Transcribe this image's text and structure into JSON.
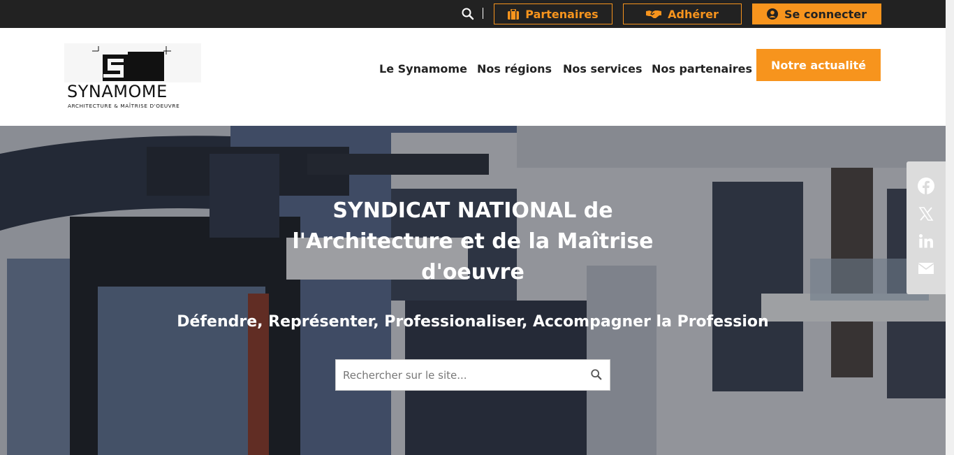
{
  "topbar": {
    "partners_label": "Partenaires",
    "join_label": "Adhérer",
    "login_label": "Se connecter"
  },
  "logo": {
    "name": "SYNAMOME",
    "tagline": "ARCHITECTURE & MAÎTRISE D'OEUVRE"
  },
  "nav": {
    "items": [
      {
        "label": "Le Synamome"
      },
      {
        "label": "Nos régions"
      },
      {
        "label": "Nos services"
      },
      {
        "label": "Nos partenaires"
      }
    ],
    "cta_label": "Notre actualité"
  },
  "hero": {
    "title": "SYNDICAT NATIONAL de l'Architecture et de la Maîtrise d'oeuvre",
    "subtitle": "Défendre, Représenter, Professionaliser, Accompagner la Profession",
    "search_placeholder": "Rechercher sur le site..."
  },
  "share": {
    "icons": [
      "facebook-icon",
      "x-icon",
      "linkedin-icon",
      "email-icon"
    ]
  },
  "colors": {
    "accent": "#f7941d",
    "topbar_bg": "#222222",
    "share_bg": "#dcdcdc"
  }
}
